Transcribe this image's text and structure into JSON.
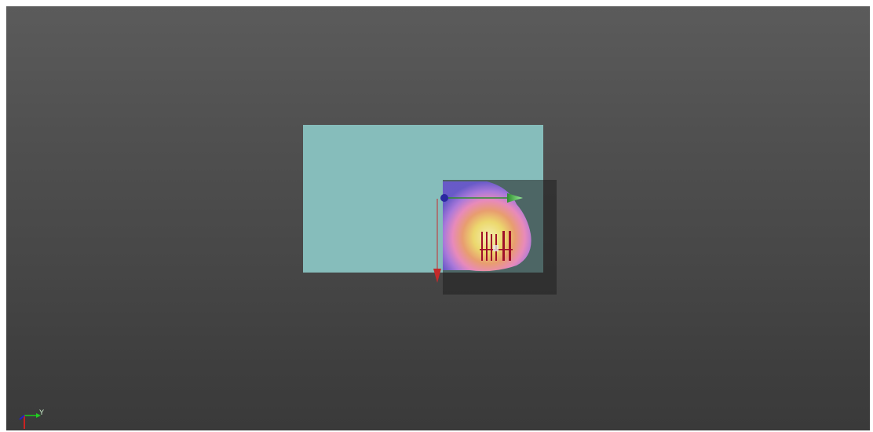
{
  "viewer": {
    "type": "3d-viewport",
    "background_top_color": "#5b5b5b",
    "background_bottom_color": "#3a3a3a"
  },
  "scene": {
    "ground_plane_color": "#86bdbb",
    "map_overlay_backdrop_color": "#333333",
    "heatmap_colors": [
      "#6a5acd",
      "#b07ae0",
      "#f08cbf",
      "#f0a070",
      "#f4de6e",
      "#fbf3a6"
    ],
    "gizmo": {
      "x_axis_color": "#2e8b2e",
      "y_axis_color": "#b22222",
      "origin_color": "#2a2aa0"
    },
    "object": {
      "name": "robot",
      "color": "#a0102a"
    }
  },
  "orientation_axes": {
    "labels": [
      "Y"
    ],
    "colors": {
      "x": "#cc2222",
      "y": "#22cc22",
      "z": "#2222cc"
    }
  }
}
